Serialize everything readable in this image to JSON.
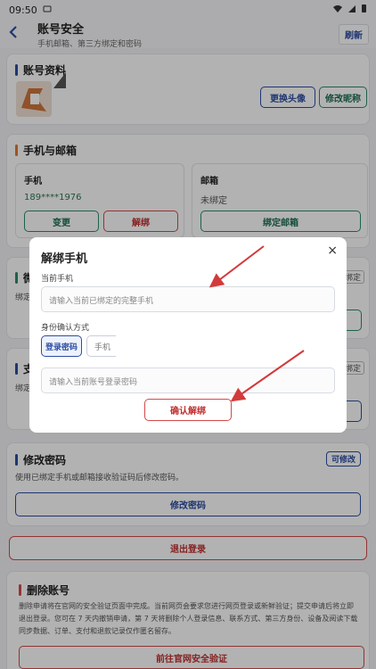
{
  "status": {
    "time": "09:50"
  },
  "appbar": {
    "title": "账号安全",
    "subtitle": "手机邮箱、第三方绑定和密码",
    "refresh": "刷新"
  },
  "profile": {
    "section": "账号资料",
    "change_avatar": "更换头像",
    "edit_nickname": "修改昵称"
  },
  "contact": {
    "section": "手机与邮箱",
    "phone": {
      "label": "手机",
      "value": "189****1976",
      "change": "变更",
      "unbind": "解绑"
    },
    "email": {
      "label": "邮箱",
      "value": "未绑定",
      "bind": "绑定邮箱"
    }
  },
  "wechat": {
    "title_partial": "微",
    "desc_partial": "绑定",
    "badge_partial": "绑定"
  },
  "alipay": {
    "title_partial": "支",
    "desc_partial": "绑定",
    "badge_partial": "绑定"
  },
  "password": {
    "section": "修改密码",
    "badge": "可修改",
    "desc": "使用已绑定手机或邮箱接收验证码后修改密码。",
    "button": "修改密码"
  },
  "logout": {
    "label": "退出登录"
  },
  "delete": {
    "section": "删除账号",
    "desc": "删除申请将在官网的安全验证页面中完成。当前网页会要求您进行网页登录或新鲜验证；提交申请后将立即退出登录。您可在 7 天内撤销申请，第 7 天将删除个人登录信息、联系方式、第三方身份、设备及阅读下载同步数据、订单、支付和退款记录仅作匿名留存。",
    "button": "前往官网安全验证"
  },
  "dialog": {
    "title": "解绑手机",
    "close": "×",
    "current_phone_label": "当前手机",
    "current_phone_placeholder": "请输入当前已绑定的完整手机",
    "verify_label": "身份确认方式",
    "tab_password": "登录密码",
    "tab_phone_partial": "手机",
    "password_placeholder": "请输入当前账号登录密码",
    "confirm": "确认解绑"
  },
  "colors": {
    "accent_blue": "#2c4da3",
    "accent_green": "#2c8b6a",
    "danger_red": "#d34a4a",
    "orange": "#e07a2f"
  }
}
